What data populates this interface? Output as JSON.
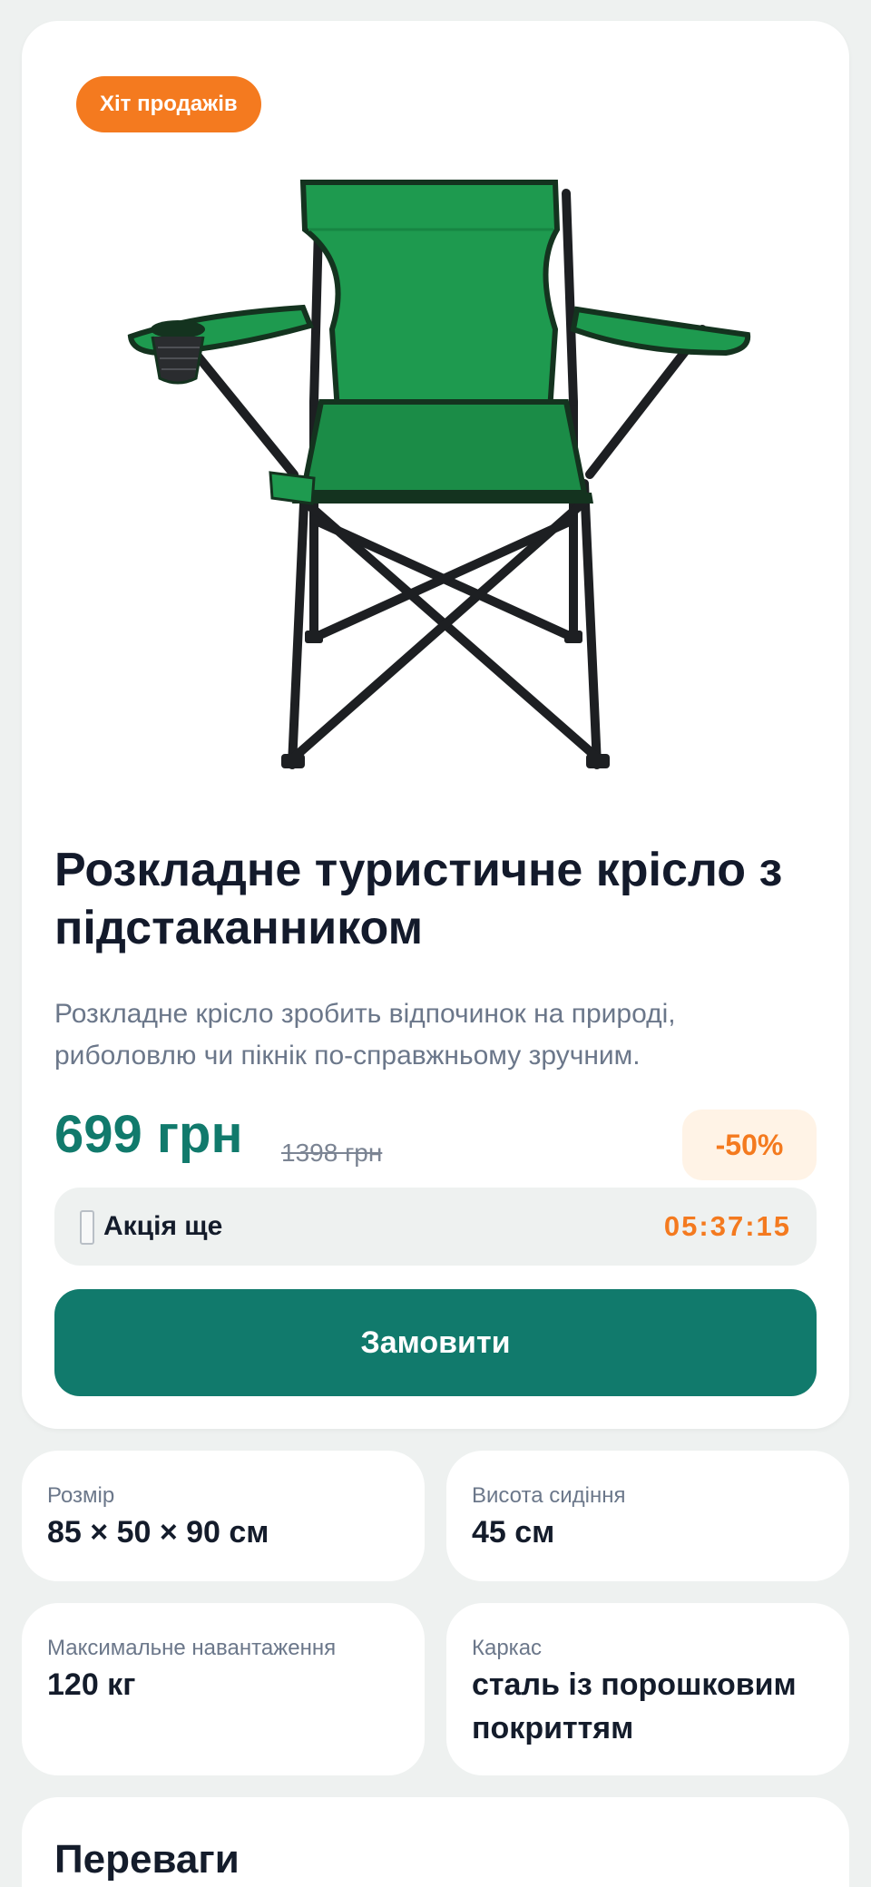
{
  "product": {
    "badge": "Хіт продажів",
    "image_alt": "green folding camping chair with cup holder",
    "title": "Розкладне туристичне крісло з підстаканником",
    "description": "Розкладне крісло зробить відпочинок на природі, риболовлю чи пікнік по-справжньому зручним.",
    "price": "699 грн",
    "old_price": "1398 грн",
    "discount": "-50%",
    "timer_label": "Акція ще",
    "timer_value": "05:37:15",
    "order_button": "Замовити"
  },
  "specs": [
    {
      "label": "Розмір",
      "value": "85 × 50 × 90 см"
    },
    {
      "label": "Висота сидіння",
      "value": "45 см"
    },
    {
      "label": "Максимальне навантаження",
      "value": "120 кг"
    },
    {
      "label": "Каркас",
      "value": "сталь із порошковим покриттям"
    }
  ],
  "advantages": {
    "title": "Переваги"
  },
  "colors": {
    "accent_green": "#117a6c",
    "accent_orange": "#f47a1f",
    "chair_fabric": "#1e9a4f",
    "page_background": "#eef1f0"
  }
}
